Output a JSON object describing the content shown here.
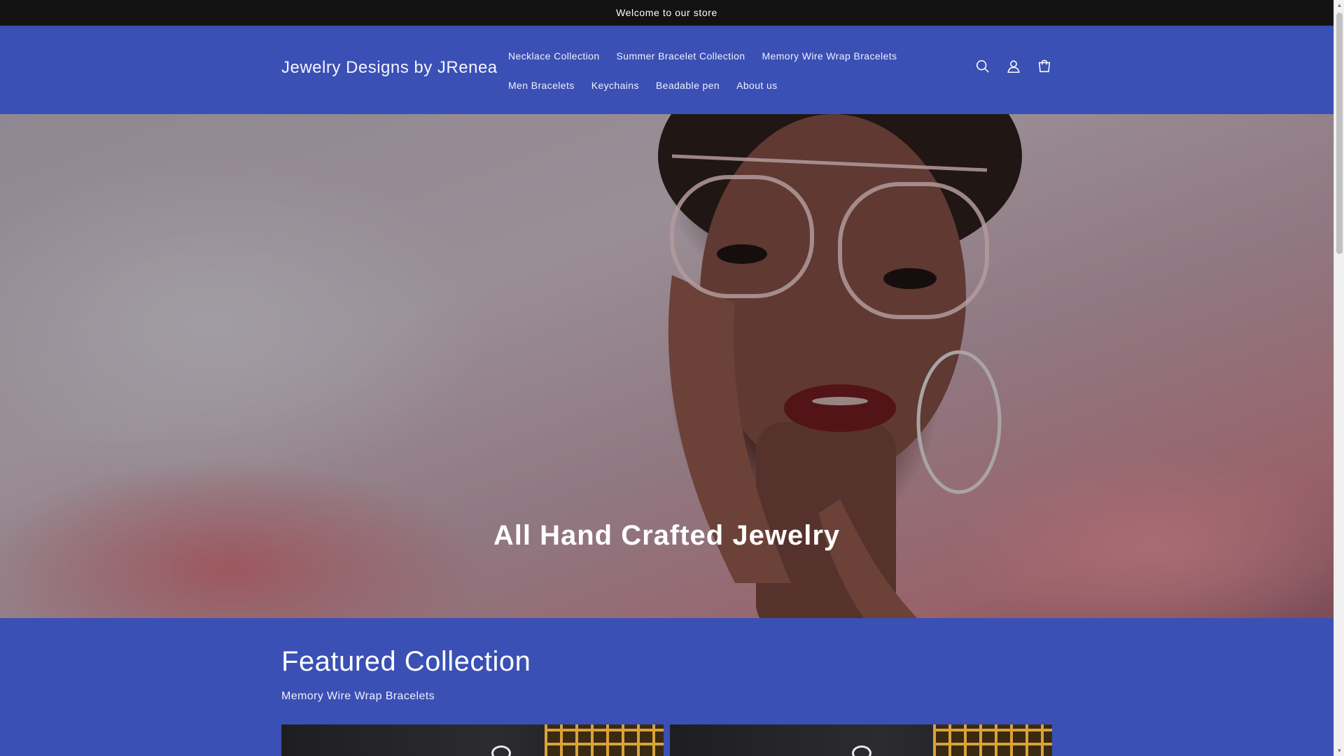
{
  "announcement": {
    "text": "Welcome to our store"
  },
  "header": {
    "logo": "Jewelry Designs by JRenea",
    "nav_row1": [
      "Necklace Collection",
      "Summer Bracelet Collection",
      "Memory Wire Wrap Bracelets"
    ],
    "nav_row2": [
      "Men Bracelets",
      "Keychains",
      "Beadable pen",
      "About us"
    ],
    "icons": [
      "search-icon",
      "account-icon",
      "cart-icon"
    ]
  },
  "hero": {
    "title": "All Hand Crafted Jewelry"
  },
  "featured": {
    "title": "Featured Collection",
    "subtitle": "Memory Wire Wrap Bracelets"
  },
  "colors": {
    "announcement_bg": "#121212",
    "brand_blue": "#3a50b4",
    "text": "#ffffff"
  }
}
